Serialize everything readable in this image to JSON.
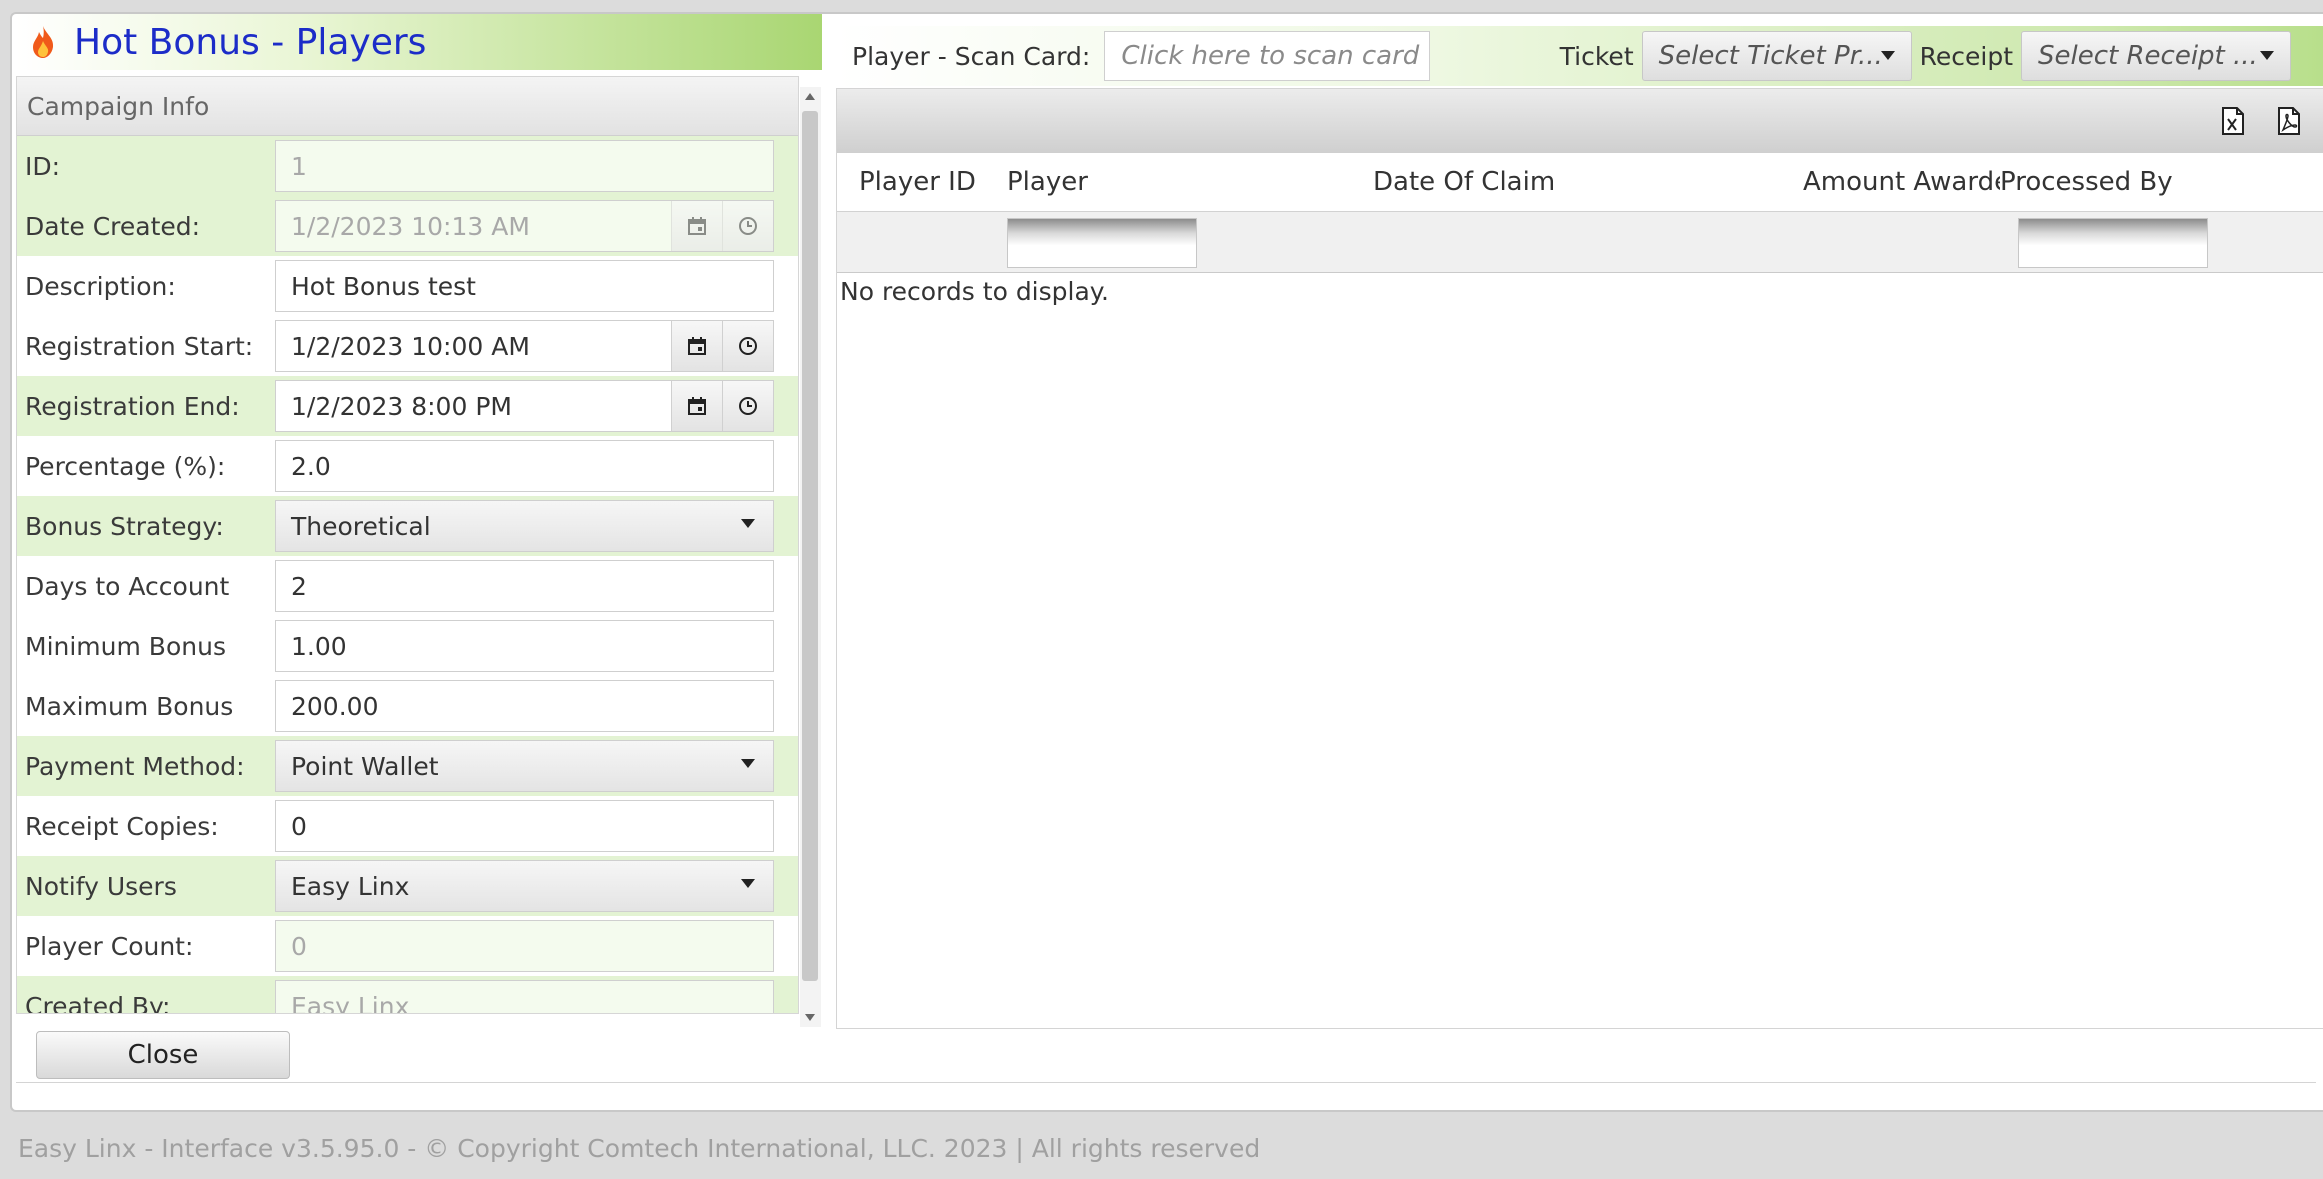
{
  "left": {
    "title": "Hot Bonus - Players",
    "section_title": "Campaign Info",
    "fields": [
      {
        "label": "ID:",
        "value": "1"
      },
      {
        "label": "Date Created:",
        "value": "1/2/2023 10:13 AM"
      },
      {
        "label": "Description:",
        "value": "Hot Bonus test"
      },
      {
        "label": "Registration Start:",
        "value": "1/2/2023 10:00 AM"
      },
      {
        "label": "Registration End:",
        "value": "1/2/2023 8:00 PM"
      },
      {
        "label": "Percentage (%):",
        "value": "2.0"
      },
      {
        "label": "Bonus Strategy:",
        "value": "Theoretical"
      },
      {
        "label": "Days to Account",
        "value": "2"
      },
      {
        "label": "Minimum Bonus",
        "value": "1.00"
      },
      {
        "label": "Maximum Bonus",
        "value": "200.00"
      },
      {
        "label": "Payment Method:",
        "value": "Point Wallet"
      },
      {
        "label": "Receipt Copies:",
        "value": "0"
      },
      {
        "label": "Notify Users",
        "value": "Easy Linx"
      },
      {
        "label": "Player Count:",
        "value": "0"
      },
      {
        "label": "Created By:",
        "value": "Easy Linx"
      }
    ],
    "close_label": "Close"
  },
  "right": {
    "scan_label": "Player - Scan Card:",
    "scan_placeholder": "Click here to scan card",
    "ticket_label": "Ticket",
    "ticket_select": "Select Ticket Pr...",
    "receipt_label": "Receipt",
    "receipt_select": "Select Receipt ...",
    "columns": [
      "Player ID",
      "Player",
      "Date Of Claim",
      "Amount Awarded",
      "Processed By"
    ],
    "empty_text": "No records to display."
  },
  "icons": {
    "header": "flame-icon",
    "calendar": "calendar-icon",
    "clock": "clock-icon",
    "excel": "excel-export-icon",
    "pdf": "pdf-export-icon"
  },
  "colors": {
    "title_blue": "#1c2cc8",
    "header_green": "#a9d672",
    "row_green": "#e3f3d3"
  },
  "footer": "Easy Linx - Interface v3.5.95.0 - © Copyright Comtech International, LLC. 2023 | All rights reserved"
}
